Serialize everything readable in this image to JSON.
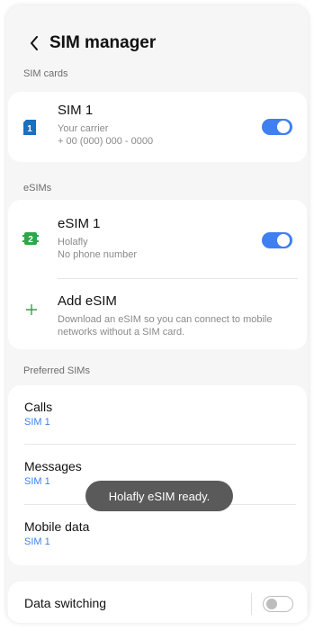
{
  "header": {
    "title": "SIM manager"
  },
  "sections": {
    "sim_cards": "SIM cards",
    "esims": "eSIMs",
    "preferred": "Preferred SIMs"
  },
  "sim1": {
    "badge": "1",
    "title": "SIM 1",
    "carrier": "Your carrier",
    "number": "+ 00 (000) 000 - 0000",
    "enabled": true
  },
  "esim1": {
    "badge": "2",
    "title": "eSIM 1",
    "carrier": "Holafly",
    "number": "No phone number",
    "enabled": true
  },
  "add_esim": {
    "title": "Add eSIM",
    "description": "Download an eSIM so you can connect to mobile networks without a SIM card."
  },
  "preferred": [
    {
      "title": "Calls",
      "value": "SIM 1"
    },
    {
      "title": "Messages",
      "value": "SIM 1"
    },
    {
      "title": "Mobile data",
      "value": "SIM 1"
    }
  ],
  "data_switching": {
    "title": "Data switching",
    "enabled": false
  },
  "toast": {
    "text": "Holafly eSIM ready."
  },
  "colors": {
    "accent": "#3e7ff2",
    "sim1_icon": "#1a6fbf",
    "esim_icon": "#2aa84a"
  }
}
